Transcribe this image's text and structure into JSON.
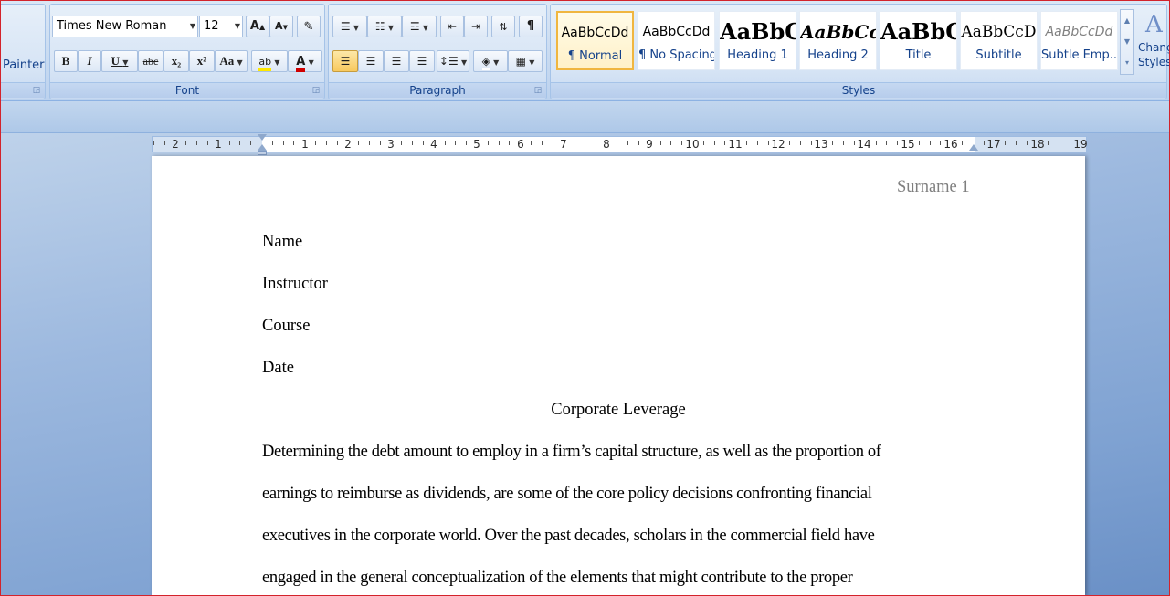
{
  "clipboard": {
    "format_painter_label": "Painter"
  },
  "font": {
    "group_label": "Font",
    "font_name": "Times New Roman",
    "font_size": "12",
    "grow_label": "A",
    "shrink_label": "A",
    "bold_label": "B",
    "italic_label": "I",
    "underline_label": "U",
    "strike_label": "abc",
    "subscript_label": "x₂",
    "superscript_label": "x²",
    "case_label": "Aa",
    "highlight_label": "ab",
    "color_label": "A"
  },
  "paragraph": {
    "group_label": "Paragraph",
    "pilcrow": "¶"
  },
  "styles": {
    "group_label": "Styles",
    "items": [
      {
        "sample": "AaBbCcDd",
        "name": "¶ Normal"
      },
      {
        "sample": "AaBbCcDd",
        "name": "¶ No Spacing"
      },
      {
        "sample": "AaBbC",
        "name": "Heading 1"
      },
      {
        "sample": "AaBbCc",
        "name": "Heading 2"
      },
      {
        "sample": "AaBbC",
        "name": "Title"
      },
      {
        "sample": "AaBbCcD",
        "name": "Subtitle"
      },
      {
        "sample": "AaBbCcDd",
        "name": "Subtle Emp..."
      }
    ],
    "change_styles_line1": "Chang",
    "change_styles_line2": "Styles"
  },
  "ruler": {
    "labels": [
      "2",
      "1",
      "1",
      "2",
      "3",
      "4",
      "5",
      "6",
      "7",
      "8",
      "9",
      "10",
      "11",
      "12",
      "13",
      "14",
      "15",
      "16",
      "17",
      "18",
      "19"
    ]
  },
  "document": {
    "header": "Surname 1",
    "lines": [
      "Name",
      "Instructor",
      "Course",
      "Date"
    ],
    "title": "Corporate Leverage",
    "body": [
      "Determining the debt amount to employ in a firm’s capital structure, as well as the proportion of",
      "earnings to reimburse as dividends, are some of the core policy decisions confronting financial",
      "executives in the corporate world. Over the past decades, scholars in the commercial field have",
      "engaged in the general conceptualization of the elements that might contribute to the proper"
    ]
  }
}
